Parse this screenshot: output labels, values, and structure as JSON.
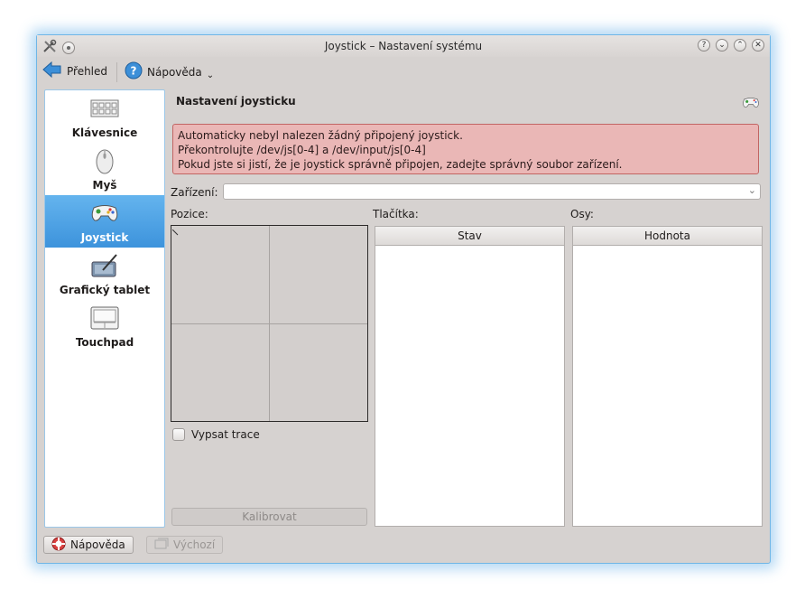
{
  "window": {
    "title": "Joystick – Nastavení systému"
  },
  "toolbar": {
    "overview_label": "Přehled",
    "help_label": "Nápověda"
  },
  "sidebar": {
    "items": [
      {
        "label": "Klávesnice",
        "icon": "keyboard-icon"
      },
      {
        "label": "Myš",
        "icon": "mouse-icon"
      },
      {
        "label": "Joystick",
        "icon": "gamepad-icon",
        "selected": true
      },
      {
        "label": "Grafický tablet",
        "icon": "tablet-icon"
      },
      {
        "label": "Touchpad",
        "icon": "touchpad-icon"
      }
    ]
  },
  "main": {
    "heading": "Nastavení joysticku",
    "alert": {
      "line1": "Automaticky nebyl nalezen žádný připojený joystick.",
      "line2": "Překontrolujte /dev/js[0-4] a /dev/input/js[0-4]",
      "line3": "Pokud jste si jistí, že je joystick správně připojen, zadejte správný soubor zařízení."
    },
    "device_label": "Zařízení:",
    "device_value": "",
    "position_label": "Pozice:",
    "buttons_label": "Tlačítka:",
    "axes_label": "Osy:",
    "buttons_table_header": "Stav",
    "axes_table_header": "Hodnota",
    "trace_label": "Vypsat trace",
    "calibrate_label": "Kalibrovat"
  },
  "footer": {
    "help_label": "Nápověda",
    "default_label": "Výchozí"
  },
  "colors": {
    "selection": "#3d93dc",
    "alert_bg": "#eab7b6",
    "alert_border": "#c26563",
    "window_glow": "#6fb6e6"
  }
}
